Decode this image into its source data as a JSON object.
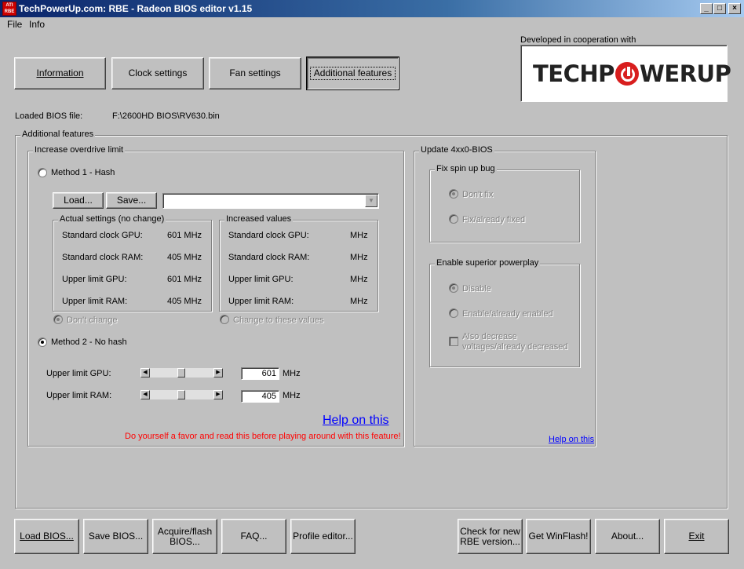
{
  "window": {
    "title": "TechPowerUp.com: RBE - Radeon BIOS editor v1.15",
    "icon_label": "ATI RBE",
    "controls": [
      "_",
      "□",
      "×"
    ]
  },
  "menu": [
    "File",
    "Info"
  ],
  "tabs": [
    "Information",
    "Clock settings",
    "Fan settings",
    "Additional features"
  ],
  "active_tab": "Additional features",
  "logo": {
    "caption": "Developed in cooperation with",
    "text_left": "TECHP",
    "text_right": "WERUP"
  },
  "loaded_bios": {
    "label": "Loaded BIOS file:",
    "path": "F:\\2600HD BIOS\\RV630.bin"
  },
  "additional_features": {
    "legend": "Additional features",
    "overdrive": {
      "legend": "Increase overdrive limit",
      "method1_label": "Method 1 - Hash",
      "load_label": "Load...",
      "save_label": "Save...",
      "actual": {
        "legend": "Actual settings (no change)",
        "rows": [
          {
            "label": "Standard clock GPU:",
            "value": "601 MHz"
          },
          {
            "label": "Standard clock RAM:",
            "value": "405 MHz"
          },
          {
            "label": "Upper limit GPU:",
            "value": "601 MHz"
          },
          {
            "label": "Upper limit RAM:",
            "value": "405 MHz"
          }
        ]
      },
      "increased": {
        "legend": "Increased values",
        "rows": [
          {
            "label": "Standard clock GPU:",
            "value": "MHz"
          },
          {
            "label": "Standard clock RAM:",
            "value": "MHz"
          },
          {
            "label": "Upper limit GPU:",
            "value": "MHz"
          },
          {
            "label": "Upper limit RAM:",
            "value": "MHz"
          }
        ]
      },
      "dont_change_label": "Don't change",
      "change_values_label": "Change to these values",
      "method2_label": "Method 2 - No hash",
      "selected_method": "Method 2 - No hash",
      "gpu": {
        "label": "Upper limit GPU:",
        "value": "601",
        "unit": "MHz",
        "slider_fraction": 0.5
      },
      "ram": {
        "label": "Upper limit RAM:",
        "value": "405",
        "unit": "MHz",
        "slider_fraction": 0.5
      },
      "help_label": "Help on this",
      "warning": "Do yourself a favor and read this before playing around with this feature!"
    },
    "update_bios": {
      "legend": "Update 4xx0-BIOS",
      "spinup": {
        "legend": "Fix spin up bug",
        "options": [
          "Don't fix",
          "Fix/already fixed"
        ],
        "selected": "Don't fix"
      },
      "powerplay": {
        "legend": "Enable superior powerplay",
        "options": [
          "Disable",
          "Enable/already enabled"
        ],
        "selected": "Disable",
        "checkbox_line1": "Also decrease",
        "checkbox_line2": "voltages/already decreased",
        "checkbox_checked": false
      },
      "help_label": "Help on this"
    }
  },
  "bottom_buttons": {
    "load_bios": "Load BIOS...",
    "save_bios": "Save BIOS...",
    "acquire_line1": "Acquire/flash",
    "acquire_line2": "BIOS...",
    "faq": "FAQ...",
    "profile_editor": "Profile editor...",
    "check_line1": "Check for new",
    "check_line2": "RBE version...",
    "get_winflash": "Get WinFlash!",
    "about": "About...",
    "exit": "Exit"
  },
  "colors": {
    "title_gradient_start": "#0a246a",
    "title_gradient_end": "#a6caf0",
    "face": "#c0c0c0",
    "link": "#0000ff",
    "warning": "#ff0000",
    "logo_accent": "#d81e1e"
  }
}
